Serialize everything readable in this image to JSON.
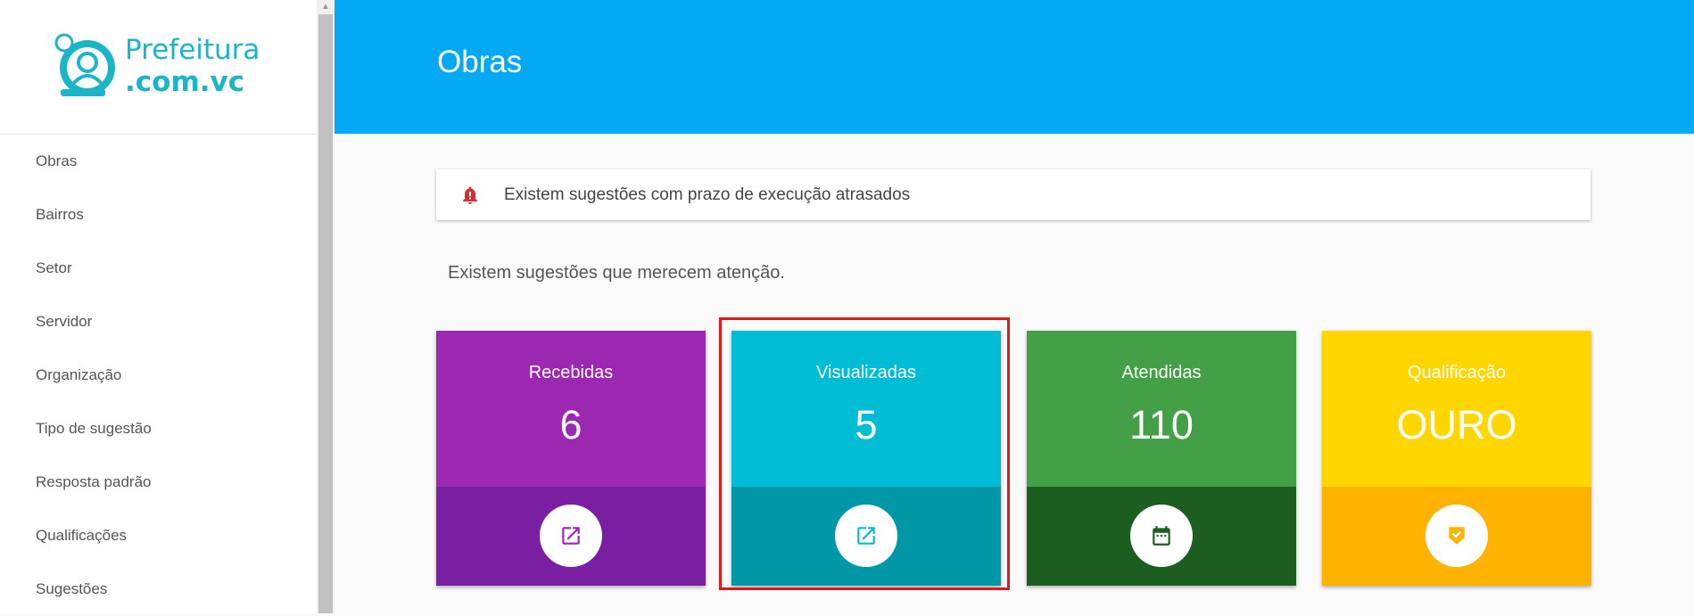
{
  "logo": {
    "line1": "Prefeitura",
    "line2": ".com.vc"
  },
  "sidebar": {
    "items": [
      {
        "label": "Obras"
      },
      {
        "label": "Bairros"
      },
      {
        "label": "Setor"
      },
      {
        "label": "Servidor"
      },
      {
        "label": "Organização"
      },
      {
        "label": "Tipo de sugestão"
      },
      {
        "label": "Resposta padrão"
      },
      {
        "label": "Qualificações"
      },
      {
        "label": "Sugestões"
      }
    ]
  },
  "header": {
    "title": "Obras"
  },
  "alert": {
    "text": "Existem sugestões com prazo de execução atrasados",
    "icon": "bell-alert-icon",
    "color": "#d32f2f"
  },
  "subtitle": "Existem sugestões que merecem atenção.",
  "cards": [
    {
      "label": "Recebidas",
      "value": "6",
      "icon": "open-external-icon",
      "color_top": "#9c27b0",
      "color_bottom": "#7b1fa2"
    },
    {
      "label": "Visualizadas",
      "value": "5",
      "icon": "open-external-icon",
      "color_top": "#00bcd4",
      "color_bottom": "#0097a7"
    },
    {
      "label": "Atendidas",
      "value": "110",
      "icon": "calendar-icon",
      "color_top": "#43a047",
      "color_bottom": "#1b5e20"
    },
    {
      "label": "Qualificação",
      "value": "OURO",
      "icon": "badge-check-icon",
      "color_top": "#ffd600",
      "color_bottom": "#ffb300"
    }
  ],
  "colors": {
    "header": "#03a9f4",
    "logo": "#1bb5c9",
    "highlight": "#e0191a"
  }
}
